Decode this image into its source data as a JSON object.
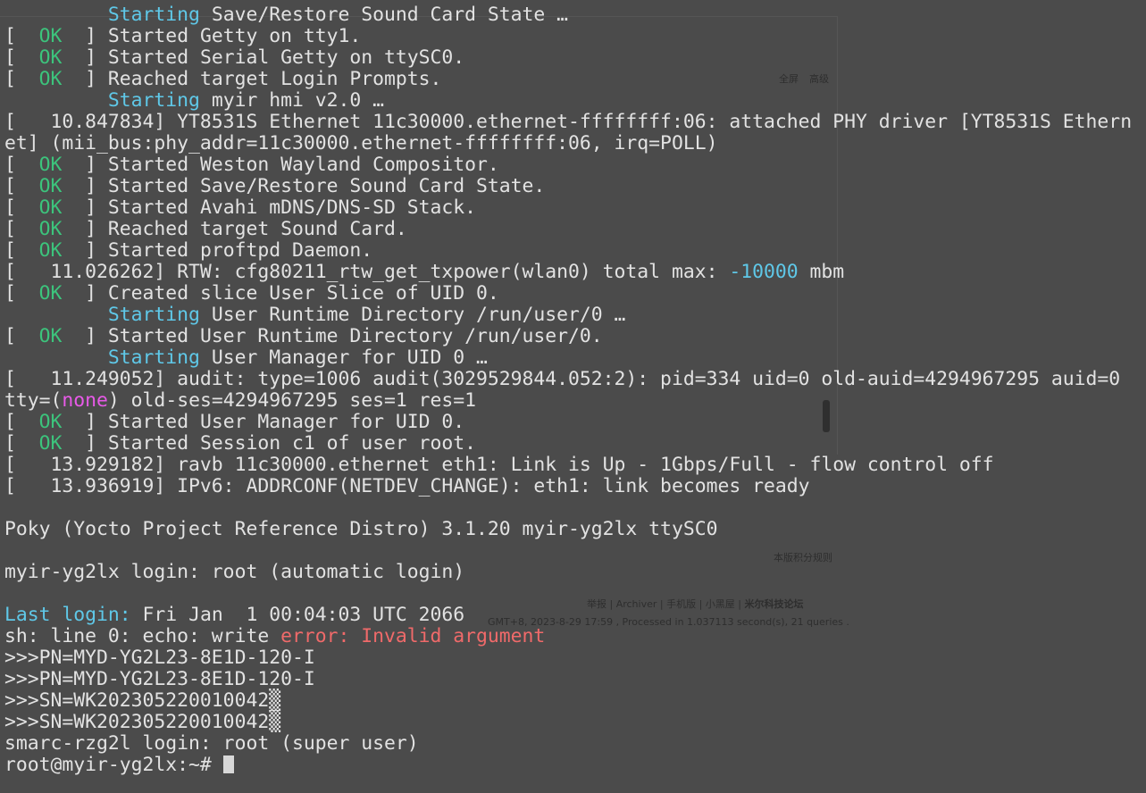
{
  "background_page": {
    "fullscreen_label": "全屏",
    "advanced_label": "高级",
    "rules_link": "本版积分规则",
    "footer_links": [
      "举报",
      "Archiver",
      "手机版",
      "小黑屋",
      "米尔科技论坛"
    ],
    "footer_info": "GMT+8, 2023-8-29 17:59 , Processed in 1.037113 second(s), 21 queries ."
  },
  "colors": {
    "background": "#4b4b4b",
    "text": "#e2e2e2",
    "cyan": "#5fc8e8",
    "green": "#3cc47c",
    "red": "#f06a6a",
    "magenta": "#e85ae8"
  },
  "terminal": {
    "lines": [
      [
        [
          "         ",
          ""
        ],
        [
          "Starting",
          "cyan"
        ],
        [
          " Save/Restore Sound Card State …",
          ""
        ]
      ],
      [
        [
          "[  ",
          ""
        ],
        [
          "OK",
          "green"
        ],
        [
          "  ] Started Getty on tty1.",
          ""
        ]
      ],
      [
        [
          "[  ",
          ""
        ],
        [
          "OK",
          "green"
        ],
        [
          "  ] Started Serial Getty on ttySC0.",
          ""
        ]
      ],
      [
        [
          "[  ",
          ""
        ],
        [
          "OK",
          "green"
        ],
        [
          "  ] Reached target Login Prompts.",
          ""
        ]
      ],
      [
        [
          "         ",
          ""
        ],
        [
          "Starting",
          "cyan"
        ],
        [
          " myir hmi v2.0 …",
          ""
        ]
      ],
      [
        [
          "[   10.847834] YT8531S Ethernet 11c30000.ethernet-ffffffff:06: attached PHY driver [YT8531S Ethern",
          ""
        ]
      ],
      [
        [
          "et] (mii_bus:phy_addr=11c30000.ethernet-ffffffff:06, irq=POLL)",
          ""
        ]
      ],
      [
        [
          "[  ",
          ""
        ],
        [
          "OK",
          "green"
        ],
        [
          "  ] Started Weston Wayland Compositor.",
          ""
        ]
      ],
      [
        [
          "[  ",
          ""
        ],
        [
          "OK",
          "green"
        ],
        [
          "  ] Started Save/Restore Sound Card State.",
          ""
        ]
      ],
      [
        [
          "[  ",
          ""
        ],
        [
          "OK",
          "green"
        ],
        [
          "  ] Started Avahi mDNS/DNS-SD Stack.",
          ""
        ]
      ],
      [
        [
          "[  ",
          ""
        ],
        [
          "OK",
          "green"
        ],
        [
          "  ] Reached target Sound Card.",
          ""
        ]
      ],
      [
        [
          "[  ",
          ""
        ],
        [
          "OK",
          "green"
        ],
        [
          "  ] Started proftpd Daemon.",
          ""
        ]
      ],
      [
        [
          "[   11.026262] RTW: cfg80211_rtw_get_txpower(wlan0) total max: ",
          ""
        ],
        [
          "-10000",
          "cyan"
        ],
        [
          " mbm",
          ""
        ]
      ],
      [
        [
          "[  ",
          ""
        ],
        [
          "OK",
          "green"
        ],
        [
          "  ] Created slice User Slice of UID 0.",
          ""
        ]
      ],
      [
        [
          "         ",
          ""
        ],
        [
          "Starting",
          "cyan"
        ],
        [
          " User Runtime Directory /run/user/0 …",
          ""
        ]
      ],
      [
        [
          "[  ",
          ""
        ],
        [
          "OK",
          "green"
        ],
        [
          "  ] Started User Runtime Directory /run/user/0.",
          ""
        ]
      ],
      [
        [
          "         ",
          ""
        ],
        [
          "Starting",
          "cyan"
        ],
        [
          " User Manager for UID 0 …",
          ""
        ]
      ],
      [
        [
          "[   11.249052] audit: type=1006 audit(3029529844.052:2): pid=334 uid=0 old-auid=4294967295 auid=0",
          ""
        ]
      ],
      [
        [
          "tty=(",
          ""
        ],
        [
          "none",
          "magenta"
        ],
        [
          ") old-ses=4294967295 ses=1 res=1",
          ""
        ]
      ],
      [
        [
          "[  ",
          ""
        ],
        [
          "OK",
          "green"
        ],
        [
          "  ] Started User Manager for UID 0.",
          ""
        ]
      ],
      [
        [
          "[  ",
          ""
        ],
        [
          "OK",
          "green"
        ],
        [
          "  ] Started Session c1 of user root.",
          ""
        ]
      ],
      [
        [
          "[   13.929182] ravb 11c30000.ethernet eth1: Link is Up - 1Gbps/Full - flow control off",
          ""
        ]
      ],
      [
        [
          "[   13.936919] IPv6: ADDRCONF(NETDEV_CHANGE): eth1: link becomes ready",
          ""
        ]
      ],
      [
        [
          "",
          ""
        ]
      ],
      [
        [
          "Poky (Yocto Project Reference Distro) 3.1.20 myir-yg2lx ttySC0",
          ""
        ]
      ],
      [
        [
          "",
          ""
        ]
      ],
      [
        [
          "myir-yg2lx login: root (automatic login)",
          ""
        ]
      ],
      [
        [
          "",
          ""
        ]
      ],
      [
        [
          "Last login:",
          "cyan"
        ],
        [
          " Fri Jan  1 00:04:03 UTC 2066",
          ""
        ]
      ],
      [
        [
          "sh: line 0: echo: write ",
          ""
        ],
        [
          "error:",
          "red"
        ],
        [
          " ",
          ""
        ],
        [
          "Invalid argument",
          "red"
        ]
      ],
      [
        [
          ">>>PN=MYD-YG2L23-8E1D-120-I",
          ""
        ]
      ],
      [
        [
          ">>>PN=MYD-YG2L23-8E1D-120-I",
          ""
        ]
      ],
      [
        [
          ">>>SN=WK202305220010042▒",
          ""
        ]
      ],
      [
        [
          ">>>SN=WK202305220010042▒",
          ""
        ]
      ],
      [
        [
          "smarc-rzg2l login: root (super user)",
          ""
        ]
      ],
      [
        [
          "root@myir-yg2lx:~# ",
          ""
        ]
      ]
    ]
  }
}
